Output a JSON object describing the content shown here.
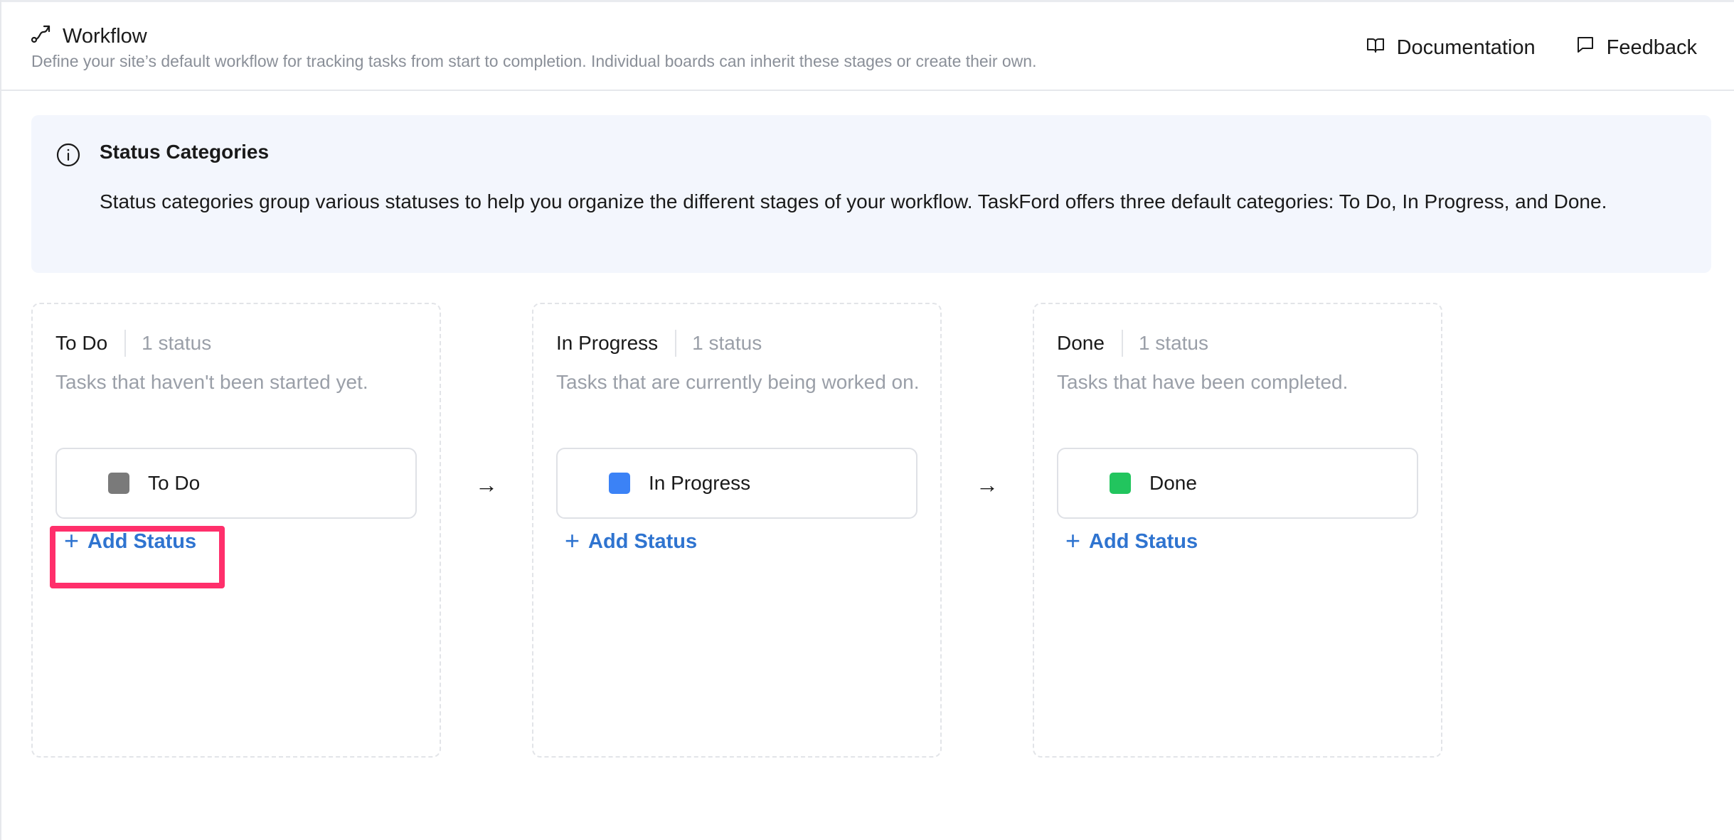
{
  "header": {
    "title": "Workflow",
    "description": "Define your site’s default workflow for tracking tasks from start to completion. Individual boards can inherit these stages or create their own.",
    "links": {
      "documentation": "Documentation",
      "feedback": "Feedback"
    }
  },
  "info": {
    "title": "Status Categories",
    "text": "Status categories group various statuses to help you organize the different stages of your workflow. TaskFord offers three default categories: To Do, In Progress, and Done."
  },
  "columns": [
    {
      "name": "To Do",
      "count": "1 status",
      "description": "Tasks that haven't been started yet.",
      "status": "To Do",
      "color": "#7a7a7a",
      "add_label": "Add Status"
    },
    {
      "name": "In Progress",
      "count": "1 status",
      "description": "Tasks that are currently being worked on.",
      "status": "In Progress",
      "color": "#3b82f6",
      "add_label": "Add Status"
    },
    {
      "name": "Done",
      "count": "1 status",
      "description": "Tasks that have been completed.",
      "status": "Done",
      "color": "#22c55e",
      "add_label": "Add Status"
    }
  ],
  "icons": {
    "workflow": "workflow-icon",
    "documentation": "book-icon",
    "feedback": "chat-icon",
    "info": "info-icon",
    "arrow": "arrow-right-icon",
    "plus": "plus-icon"
  },
  "accent_color": "#2f74d0",
  "highlight_color": "#ff2f6b"
}
